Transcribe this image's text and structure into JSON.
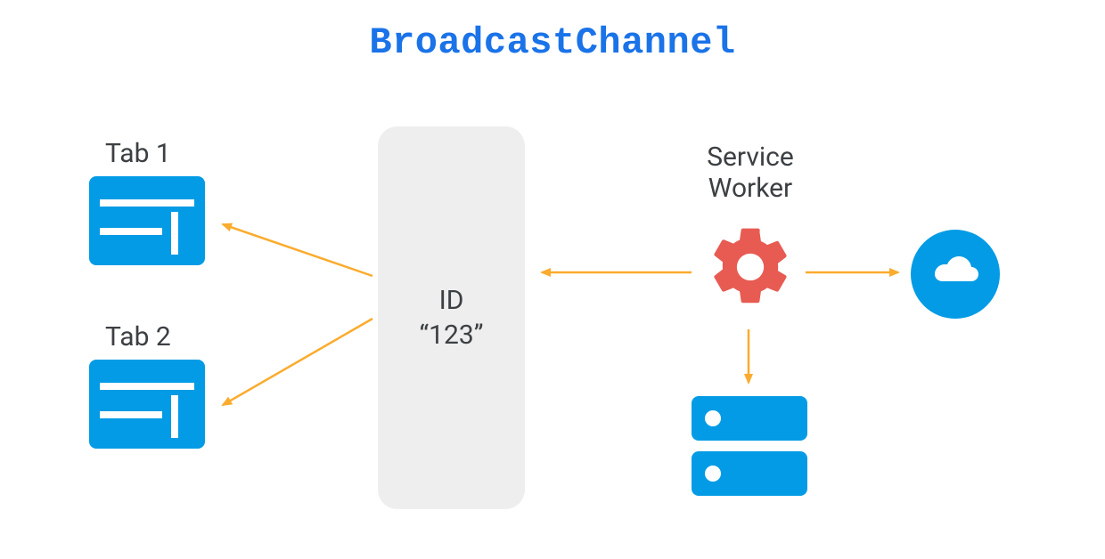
{
  "title": "BroadcastChannel",
  "tabs": {
    "tab1": "Tab 1",
    "tab2": "Tab 2"
  },
  "channel": {
    "line1": "ID",
    "line2": "“123”"
  },
  "service_worker_label": "Service\nWorker",
  "colors": {
    "title": "#1a73e8",
    "icon_blue": "#039be5",
    "gear_red": "#e75b52",
    "arrow_orange": "#fbab2d",
    "channel_bg": "#eeeeee",
    "text": "#3c4043"
  },
  "nodes": [
    {
      "id": "tab1",
      "type": "browser-tab",
      "label_key": "tabs.tab1"
    },
    {
      "id": "tab2",
      "type": "browser-tab",
      "label_key": "tabs.tab2"
    },
    {
      "id": "channel",
      "type": "broadcast-channel",
      "label_key": "channel"
    },
    {
      "id": "service-worker",
      "type": "service-worker",
      "label_key": "service_worker_label"
    },
    {
      "id": "storage",
      "type": "storage"
    },
    {
      "id": "cloud",
      "type": "cloud"
    }
  ],
  "arrows": [
    {
      "from": "channel",
      "to": "tab1"
    },
    {
      "from": "channel",
      "to": "tab2"
    },
    {
      "from": "service-worker",
      "to": "channel"
    },
    {
      "from": "service-worker",
      "to": "cloud"
    },
    {
      "from": "service-worker",
      "to": "storage"
    }
  ]
}
